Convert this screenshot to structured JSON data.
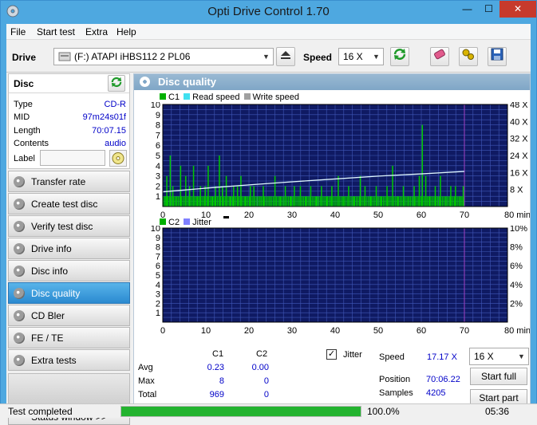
{
  "window": {
    "title": "Opti Drive Control 1.70",
    "minimize": "—",
    "maximize": "☐",
    "close": "✕"
  },
  "menu": [
    "File",
    "Start test",
    "Extra",
    "Help"
  ],
  "toolbar": {
    "drive_label": "Drive",
    "drive_value": "(F:)   ATAPI iHBS112   2 PL06",
    "speed_label": "Speed",
    "speed_value": "16 X"
  },
  "disc": {
    "header": "Disc",
    "rows": [
      {
        "key": "Type",
        "value": "CD-R"
      },
      {
        "key": "MID",
        "value": "97m24s01f"
      },
      {
        "key": "Length",
        "value": "70:07.15"
      },
      {
        "key": "Contents",
        "value": "audio"
      }
    ],
    "label_key": "Label"
  },
  "nav": [
    "Transfer rate",
    "Create test disc",
    "Verify test disc",
    "Drive info",
    "Disc info",
    "Disc quality",
    "CD Bler",
    "FE / TE",
    "Extra tests"
  ],
  "nav_active": 5,
  "status_window": "Status window >>",
  "panel_title": "Disc quality",
  "chart_data": [
    {
      "type": "bar",
      "legend": [
        "C1",
        "Read speed",
        "Write speed"
      ],
      "xlabel": "min",
      "xlim": [
        0,
        80
      ],
      "ylim": [
        0,
        10
      ],
      "x_ticks": [
        "0",
        "10",
        "20",
        "30",
        "40",
        "50",
        "60",
        "70",
        "80 min"
      ],
      "y_ticks": [
        "1",
        "2",
        "3",
        "4",
        "5",
        "6",
        "7",
        "8",
        "9",
        "10"
      ],
      "y2_ticks": [
        "8 X",
        "16 X",
        "24 X",
        "32 X",
        "40 X",
        "48 X"
      ],
      "y2lim": [
        0,
        50
      ],
      "spikes": [
        [
          0.4,
          1
        ],
        [
          0.8,
          3
        ],
        [
          1.6,
          5
        ],
        [
          2.2,
          2
        ],
        [
          3.1,
          1
        ],
        [
          4.0,
          4
        ],
        [
          5.2,
          3
        ],
        [
          6.1,
          2
        ],
        [
          7.0,
          4
        ],
        [
          7.8,
          1
        ],
        [
          8.6,
          2
        ],
        [
          9.7,
          2
        ],
        [
          10.4,
          4
        ],
        [
          11.3,
          1
        ],
        [
          12.1,
          2
        ],
        [
          13.0,
          5
        ],
        [
          13.7,
          2
        ],
        [
          14.6,
          3
        ],
        [
          15.5,
          1
        ],
        [
          16.3,
          2
        ],
        [
          17.2,
          2
        ],
        [
          18.0,
          3
        ],
        [
          19.1,
          1
        ],
        [
          20.2,
          2
        ],
        [
          21.0,
          2
        ],
        [
          22.4,
          1
        ],
        [
          23.2,
          2
        ],
        [
          24.8,
          1
        ],
        [
          25.9,
          3
        ],
        [
          27.1,
          1
        ],
        [
          28.3,
          2
        ],
        [
          29.6,
          1
        ],
        [
          30.4,
          2
        ],
        [
          31.8,
          2
        ],
        [
          33.0,
          1
        ],
        [
          34.2,
          2
        ],
        [
          35.5,
          1
        ],
        [
          36.7,
          2
        ],
        [
          37.9,
          1
        ],
        [
          39.1,
          2
        ],
        [
          40.6,
          3
        ],
        [
          41.9,
          1
        ],
        [
          43.0,
          2
        ],
        [
          44.3,
          1
        ],
        [
          45.7,
          3
        ],
        [
          46.8,
          2
        ],
        [
          48.1,
          1
        ],
        [
          49.4,
          2
        ],
        [
          50.6,
          1
        ],
        [
          51.9,
          2
        ],
        [
          53.2,
          4
        ],
        [
          54.5,
          1
        ],
        [
          55.7,
          2
        ],
        [
          57.0,
          1
        ],
        [
          58.2,
          2
        ],
        [
          59.4,
          3
        ],
        [
          60.1,
          8
        ],
        [
          60.9,
          3
        ],
        [
          61.8,
          1
        ],
        [
          63.1,
          2
        ],
        [
          64.3,
          3
        ],
        [
          65.5,
          1
        ],
        [
          66.7,
          2
        ],
        [
          67.8,
          2
        ],
        [
          68.9,
          1
        ],
        [
          69.6,
          2
        ]
      ],
      "read_speed": [
        [
          0,
          7.2
        ],
        [
          10,
          9.0
        ],
        [
          20,
          10.6
        ],
        [
          30,
          12.1
        ],
        [
          40,
          13.5
        ],
        [
          50,
          14.9
        ],
        [
          60,
          16.0
        ],
        [
          70,
          17.2
        ]
      ]
    },
    {
      "type": "bar",
      "legend": [
        "C2",
        "Jitter"
      ],
      "xlabel": "min",
      "xlim": [
        0,
        80
      ],
      "ylim": [
        0,
        10
      ],
      "x_ticks": [
        "0",
        "10",
        "20",
        "30",
        "40",
        "50",
        "60",
        "70",
        "80 min"
      ],
      "y_ticks": [
        "1",
        "2",
        "3",
        "4",
        "5",
        "6",
        "7",
        "8",
        "9",
        "10"
      ],
      "y2_ticks": [
        "2%",
        "4%",
        "6%",
        "8%",
        "10%"
      ],
      "y2lim": [
        0,
        10
      ]
    }
  ],
  "stats": {
    "headers": [
      "C1",
      "C2"
    ],
    "rows": [
      {
        "label": "Avg",
        "c1": "0.23",
        "c2": "0.00"
      },
      {
        "label": "Max",
        "c1": "8",
        "c2": "0"
      },
      {
        "label": "Total",
        "c1": "969",
        "c2": "0"
      }
    ],
    "jitter_label": "Jitter",
    "jitter_checked": "✓",
    "speed_label": "Speed",
    "speed_value": "17.17 X",
    "speed_select": "16 X",
    "position_label": "Position",
    "position_value": "70:06.22",
    "samples_label": "Samples",
    "samples_value": "4205",
    "start_full": "Start full",
    "start_part": "Start part"
  },
  "status": {
    "text": "Test completed",
    "progress": 100,
    "progress_text": "100.0%",
    "time": "05:36"
  },
  "colors": {
    "plot_bg": "#0f1a63",
    "grid": "#4058b8",
    "c1": "#00c800",
    "read_speed": "#e0f8ff",
    "accent": "#2b8ad0"
  }
}
